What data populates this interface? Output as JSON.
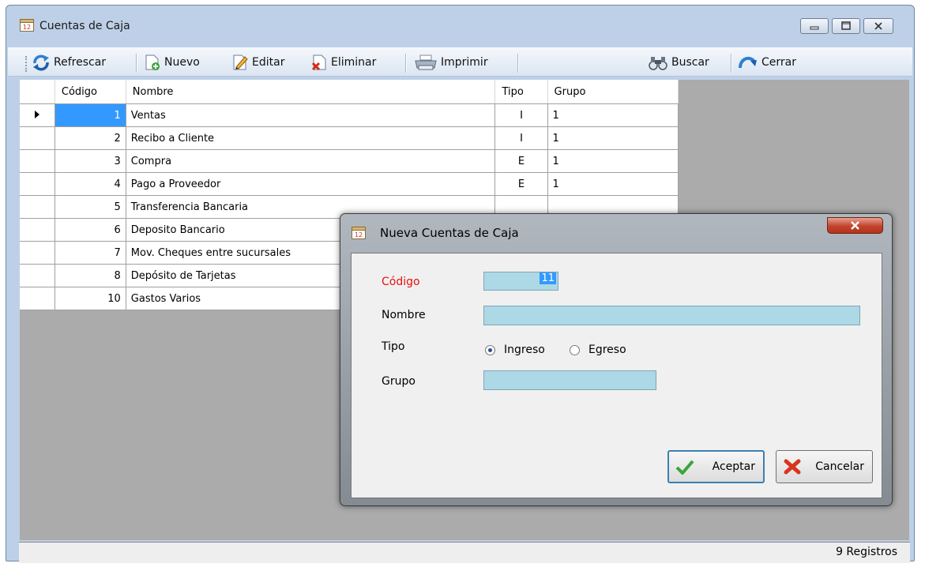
{
  "window": {
    "title": "Cuentas de Caja"
  },
  "toolbar": {
    "refresh": "Refrescar",
    "new": "Nuevo",
    "edit": "Editar",
    "delete": "Eliminar",
    "print": "Imprimir",
    "search": "Buscar",
    "close": "Cerrar"
  },
  "grid": {
    "columns": [
      "Código",
      "Nombre",
      "Tipo",
      "Grupo"
    ],
    "rows": [
      {
        "code": "1",
        "name": "Ventas",
        "type": "I",
        "group": "1"
      },
      {
        "code": "2",
        "name": "Recibo a Cliente",
        "type": "I",
        "group": "1"
      },
      {
        "code": "3",
        "name": "Compra",
        "type": "E",
        "group": "1"
      },
      {
        "code": "4",
        "name": "Pago a Proveedor",
        "type": "E",
        "group": "1"
      },
      {
        "code": "5",
        "name": "Transferencia Bancaria",
        "type": "",
        "group": ""
      },
      {
        "code": "6",
        "name": "Deposito Bancario",
        "type": "",
        "group": ""
      },
      {
        "code": "7",
        "name": "Mov. Cheques entre sucursales",
        "type": "",
        "group": ""
      },
      {
        "code": "8",
        "name": "Depósito de Tarjetas",
        "type": "",
        "group": ""
      },
      {
        "code": "10",
        "name": "Gastos Varios",
        "type": "",
        "group": ""
      }
    ]
  },
  "status": {
    "records": "9 Registros"
  },
  "dialog": {
    "title": "Nueva Cuentas de Caja",
    "code_label": "Código",
    "code_value": "11",
    "name_label": "Nombre",
    "name_value": "",
    "type_label": "Tipo",
    "type_options": [
      "Ingreso",
      "Egreso"
    ],
    "group_label": "Grupo",
    "group_value": "",
    "accept": "Aceptar",
    "cancel": "Cancelar"
  },
  "colors": {
    "selection": "#3399ff",
    "input_bg": "#add8e6",
    "required_label": "#e81010",
    "close_button": "#c2432d"
  }
}
